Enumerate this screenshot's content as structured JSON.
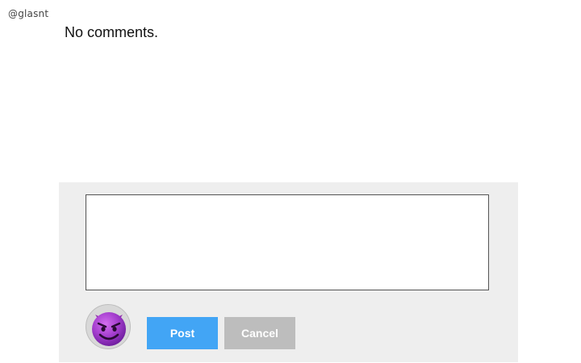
{
  "user": {
    "handle": "@glasnt"
  },
  "comments": {
    "empty_message": "No comments."
  },
  "composer": {
    "input_value": "",
    "input_placeholder": "",
    "avatar_icon": "smiling-devil-icon",
    "post_label": "Post",
    "cancel_label": "Cancel"
  },
  "colors": {
    "panel_background": "#eeeeee",
    "post_button": "#42a5f5",
    "cancel_button": "#bdbdbd",
    "avatar_purple": "#9c27b0"
  }
}
